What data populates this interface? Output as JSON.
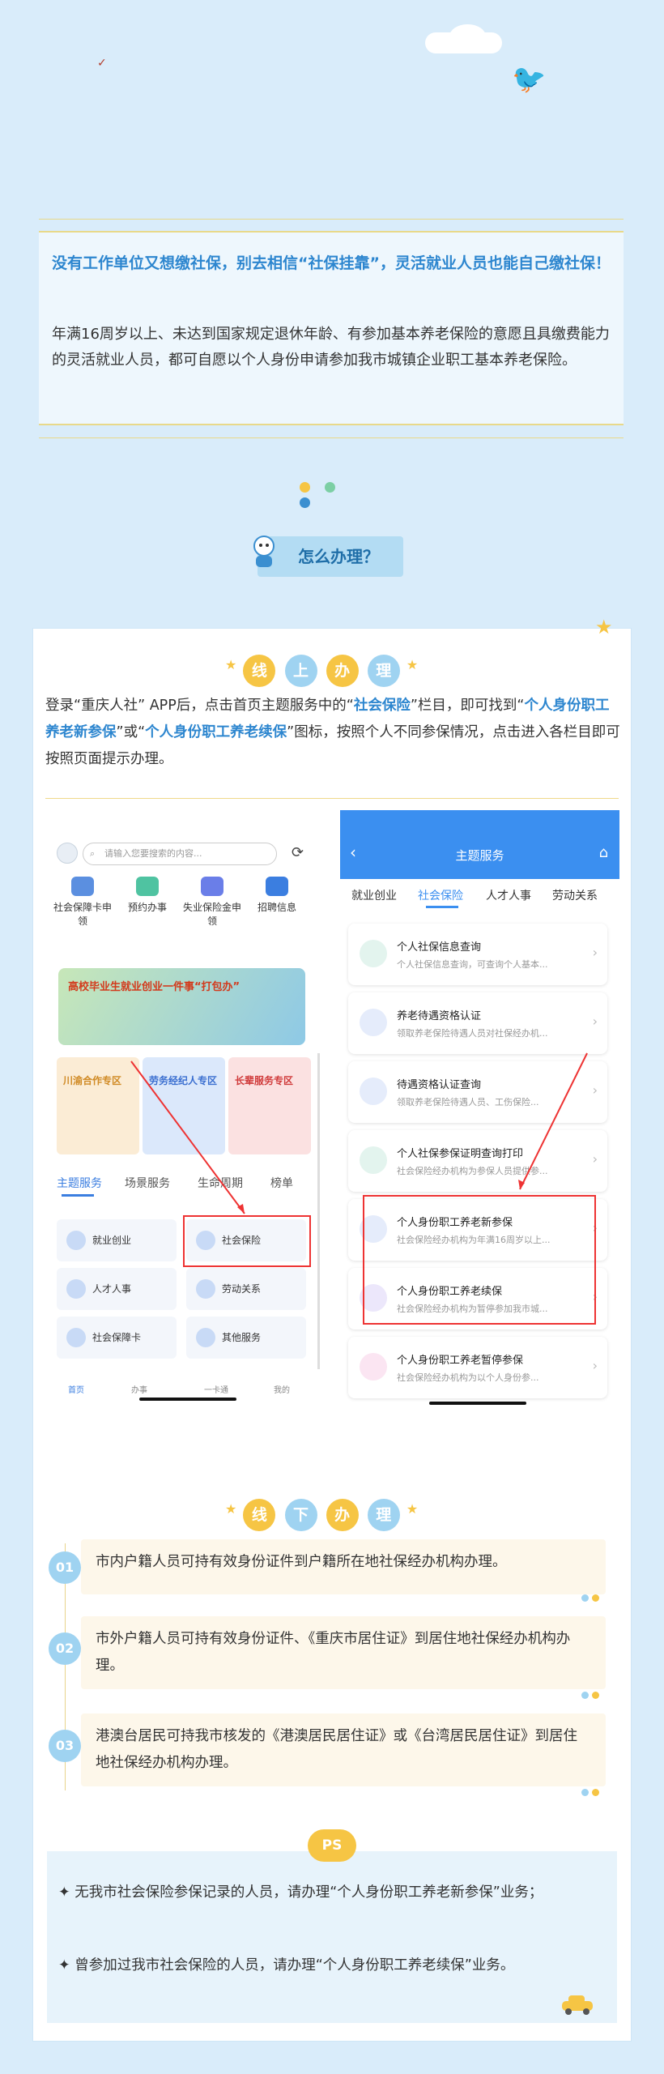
{
  "intro": {
    "headline": "没有工作单位又想缴社保，别去相信“社保挂靠”，灵活就业人员也能自己缴社保！",
    "body": "年满16周岁以上、未达到国家规定退休年龄、有参加基本养老保险的意愿且具缴费能力的灵活就业人员，都可自愿以个人身份申请参加我市城镇企业职工基本养老保险。"
  },
  "howto_label": "怎么办理？",
  "online": {
    "title_chars": [
      "线",
      "上",
      "办",
      "理"
    ],
    "text_1": "登录“重庆人社” APP后，点击首页主题服务中的“",
    "hl_1": "社会保险",
    "text_2": "”栏目，即可找到“",
    "hl_2": "个人身份职工养老新参保",
    "text_3": "”或“",
    "hl_3": "个人身份职工养老续保",
    "text_4": "”图标，按照个人不同参保情况，点击进入各栏目即可按照页面提示办理。"
  },
  "phoneA": {
    "search_placeholder": "请输入您要搜索的内容...",
    "quick": [
      "社会保障卡申领",
      "预约办事",
      "失业保险金申领",
      "招聘信息"
    ],
    "banner": "高校毕业生就业创业一件事“打包办”",
    "zones": [
      "川渝合作专区",
      "劳务经纪人专区",
      "长辈服务专区"
    ],
    "tabs": [
      "主题服务",
      "场景服务",
      "生命周期",
      "榜单"
    ],
    "services": [
      "就业创业",
      "社会保险",
      "人才人事",
      "劳动关系",
      "社会保障卡",
      "其他服务"
    ],
    "nav": [
      "首页",
      "办事",
      "一卡通",
      "我的"
    ]
  },
  "phoneB": {
    "title": "主题服务",
    "tabs": [
      "就业创业",
      "社会保险",
      "人才人事",
      "劳动关系"
    ],
    "items": [
      {
        "title": "个人社保信息查询",
        "sub": "个人社保信息查询，可查询个人基本..."
      },
      {
        "title": "养老待遇资格认证",
        "sub": "领取养老保险待遇人员对社保经办机..."
      },
      {
        "title": "待遇资格认证查询",
        "sub": "领取养老保险待遇人员、工伤保险..."
      },
      {
        "title": "个人社保参保证明查询打印",
        "sub": "社会保险经办机构为参保人员提供参..."
      },
      {
        "title": "个人身份职工养老新参保",
        "sub": "社会保险经办机构为年满16周岁以上..."
      },
      {
        "title": "个人身份职工养老续保",
        "sub": "社会保险经办机构为暂停参加我市城..."
      },
      {
        "title": "个人身份职工养老暂停参保",
        "sub": "社会保险经办机构为以个人身份参..."
      }
    ]
  },
  "offline": {
    "title_chars": [
      "线",
      "下",
      "办",
      "理"
    ],
    "steps": [
      {
        "num": "01",
        "text": "市内户籍人员可持有效身份证件到户籍所在地社保经办机构办理。"
      },
      {
        "num": "02",
        "text": "市外户籍人员可持有效身份证件、《重庆市居住证》到居住地社保经办机构办理。"
      },
      {
        "num": "03",
        "text": "港澳台居民可持我市核发的《港澳居民居住证》或《台湾居民居住证》到居住地社保经办机构办理。"
      }
    ]
  },
  "ps": {
    "badge": "PS",
    "line_1": "✦ 无我市社会保险参保记录的人员，请办理“个人身份职工养老新参保”业务；",
    "line_2": "✦ 曾参加过我市社会保险的人员，请办理“个人身份职工养老续保”业务。"
  },
  "colors": {
    "accent_blue": "#2d86cf",
    "yellow": "#f6c544",
    "light_blue": "#9fd3f1",
    "red_marker": "#e33333"
  }
}
